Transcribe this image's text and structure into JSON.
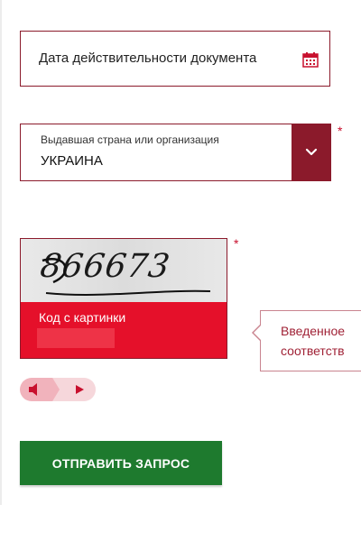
{
  "date_field": {
    "label": "Дата действительности документа",
    "icon": "calendar-icon"
  },
  "country_select": {
    "caption": "Выдавшая страна или организация",
    "value": "УКРАИНА",
    "required_mark": "*",
    "dropdown_icon": "chevron-down-icon"
  },
  "captcha": {
    "image_text": "866673",
    "label": "Код с картинки",
    "input_value": "",
    "required_mark": "*"
  },
  "tooltip": {
    "line1": "Введенное",
    "line2": "соответств"
  },
  "audio": {
    "speaker_icon": "speaker-icon",
    "play_icon": "play-icon"
  },
  "submit": {
    "label": "ОТПРАВИТЬ ЗАПРОС"
  },
  "colors": {
    "accent": "#8b1a2b",
    "captcha_red": "#e5102a",
    "submit_green": "#1e7a2e",
    "required": "#c8102e"
  }
}
